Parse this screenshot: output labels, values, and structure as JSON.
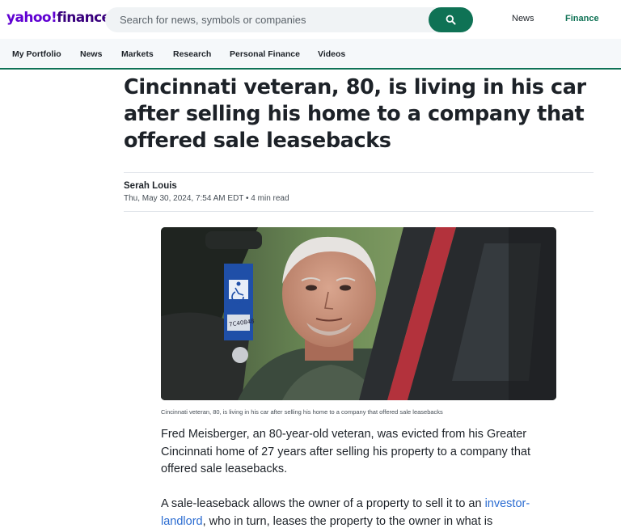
{
  "header": {
    "logo_brand": "yahoo!",
    "logo_product": "finance",
    "search_placeholder": "Search for news, symbols or companies",
    "links": {
      "news": "News",
      "finance": "Finance"
    }
  },
  "nav": [
    "My Portfolio",
    "News",
    "Markets",
    "Research",
    "Personal Finance",
    "Videos"
  ],
  "article": {
    "headline": "Cincinnati veteran, 80, is living in his car after selling his home to a company that offered sale leasebacks",
    "author": "Serah Louis",
    "date": "Thu, May 30, 2024, 7:54 AM EDT",
    "read_time": "4 min read",
    "photo_sign_text": "7C40848",
    "caption": "Cincinnati veteran, 80, is living in his car after selling his home to a company that offered sale leasebacks",
    "paragraph1": "Fred Meisberger, an 80-year-old veteran, was evicted from his Greater Cincinnati home of 27 years after selling his property to a company that offered sale leasebacks.",
    "paragraph2_start": "A sale-leaseback allows the owner of a property to sell it to an ",
    "paragraph2_link": "investor-landlord",
    "paragraph2_end": ", who in turn, leases the property to the owner in what is"
  },
  "colors": {
    "brand_purple": "#6001d2",
    "finance_green": "#0f7255",
    "link_blue": "#2b6cd1"
  }
}
